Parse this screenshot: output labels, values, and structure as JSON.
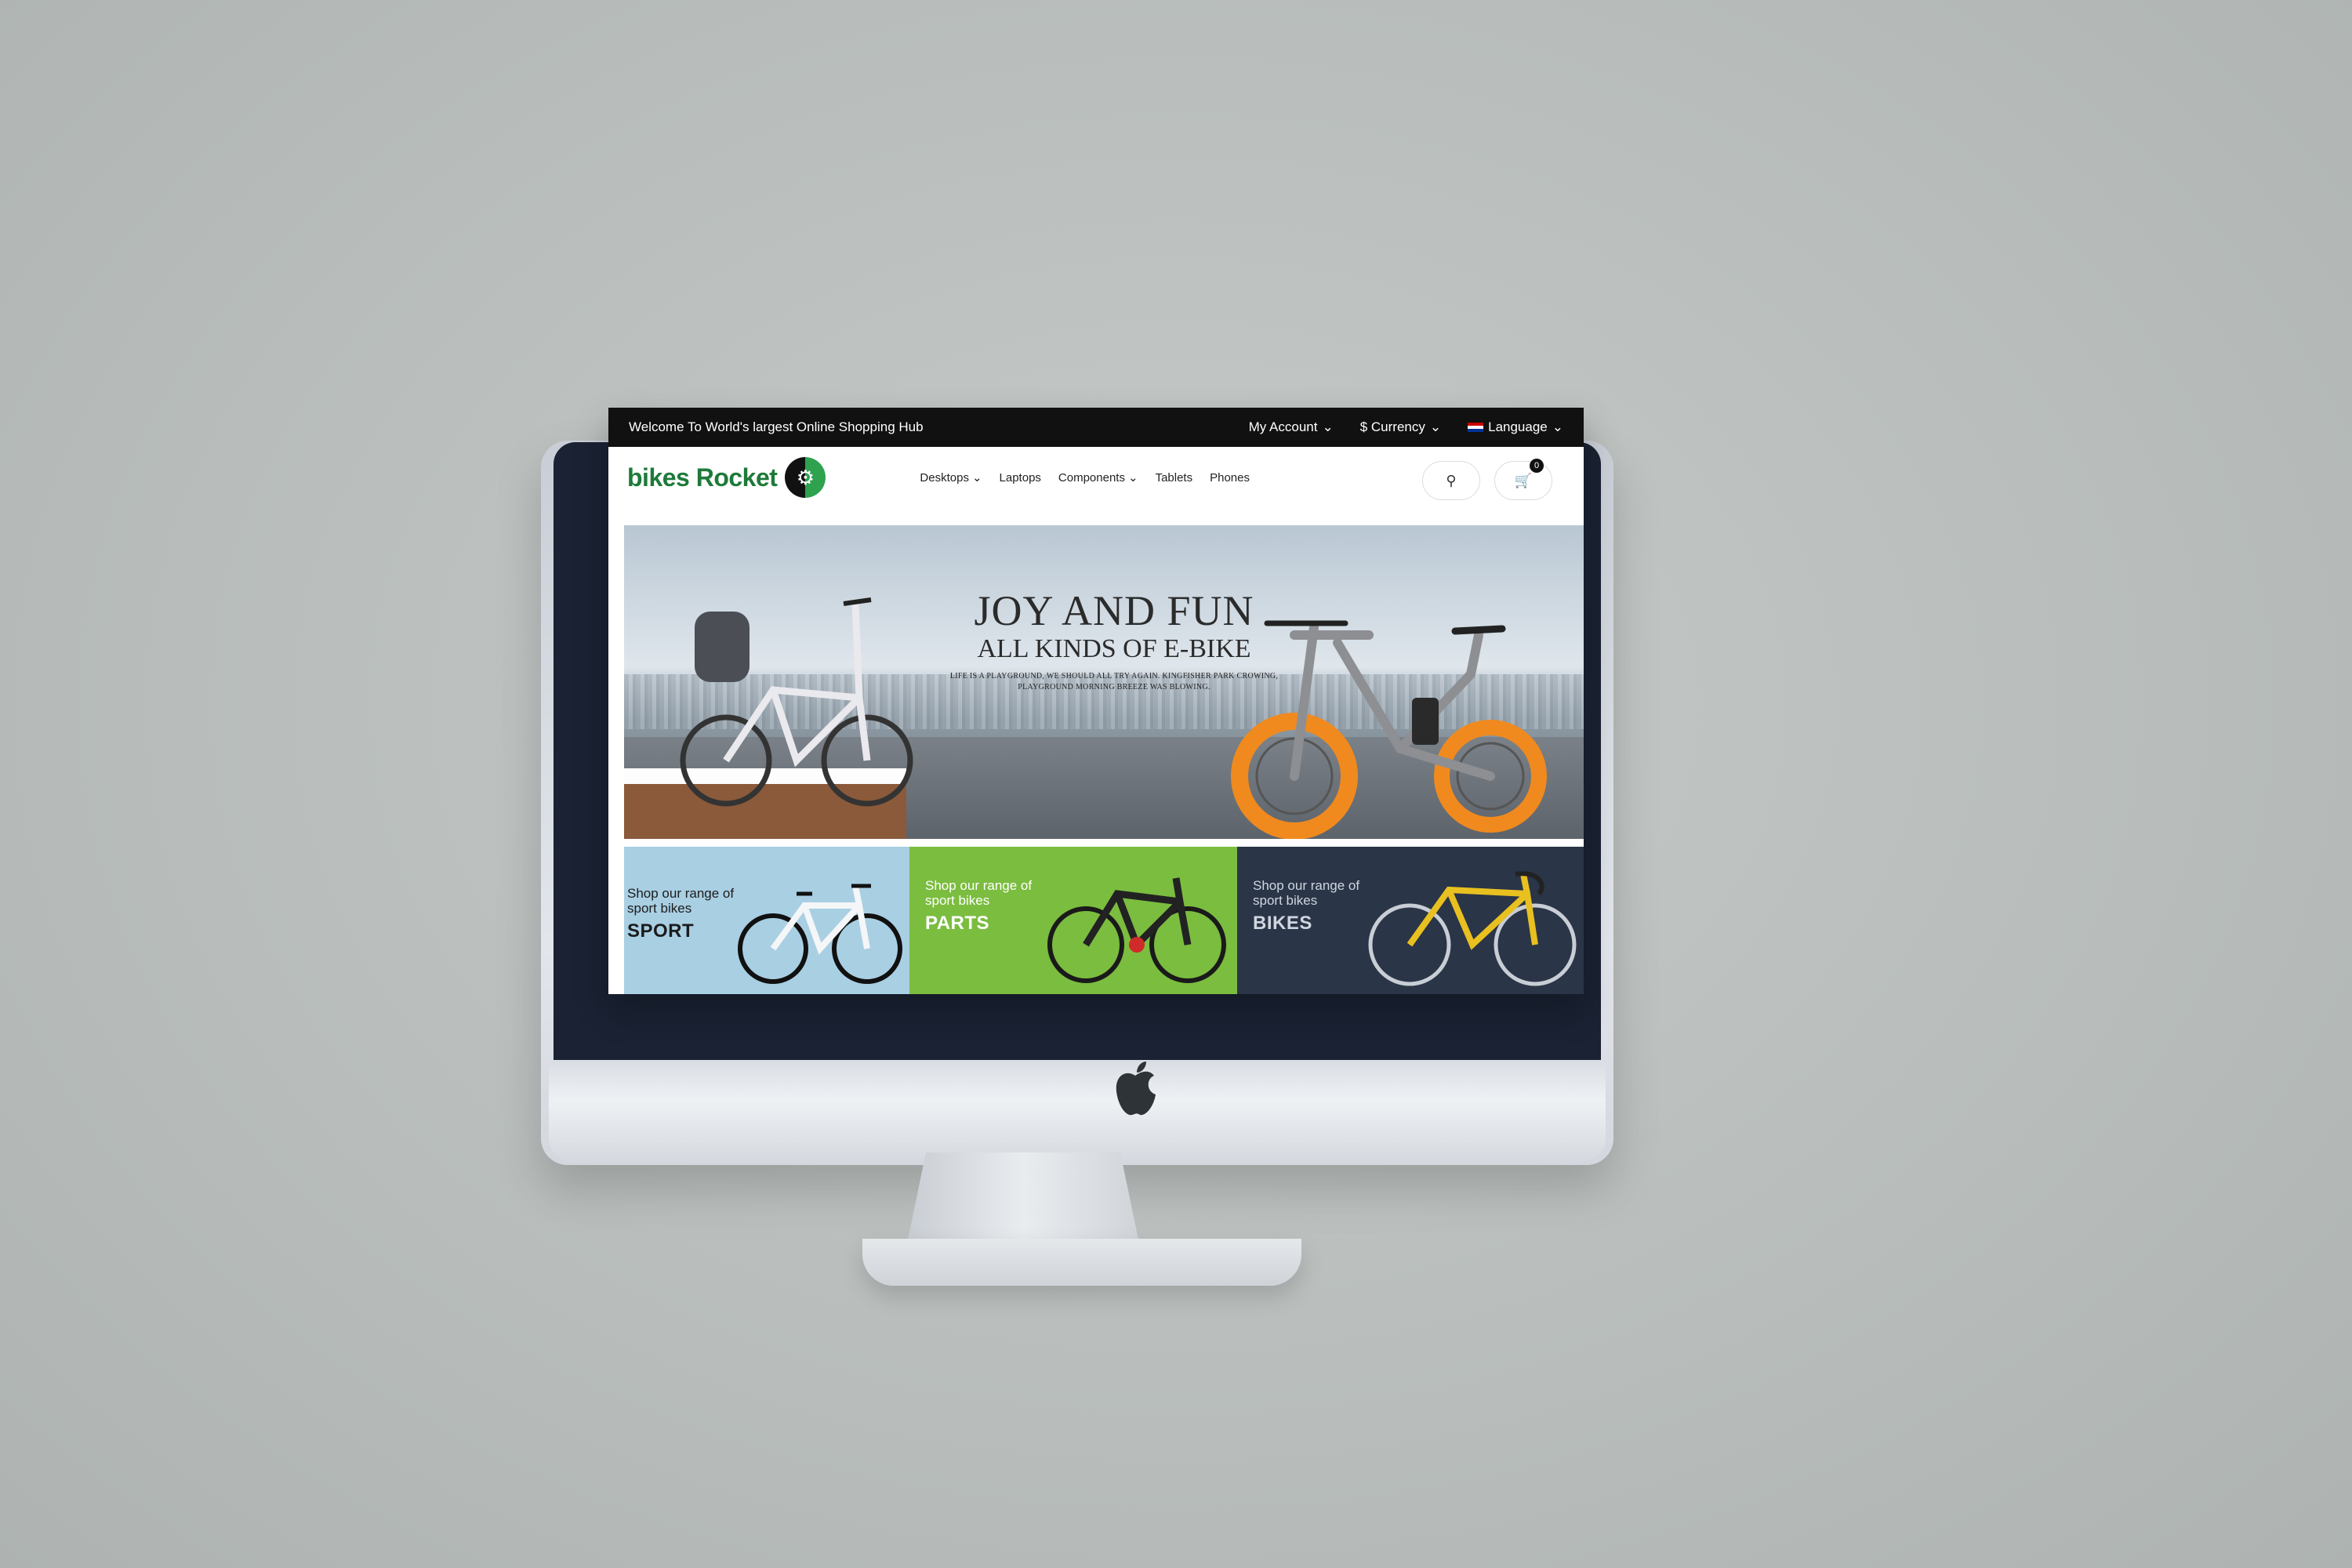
{
  "topbar": {
    "welcome": "Welcome To World's largest Online Shopping Hub",
    "my_account": "My Account",
    "currency": "$ Currency",
    "language": "Language"
  },
  "header": {
    "logo_word1": "bikes",
    "logo_word2": "Rocket",
    "cart_count": "0"
  },
  "nav": {
    "items": [
      "Desktops",
      "Laptops",
      "Components",
      "Tablets",
      "Phones"
    ]
  },
  "hero": {
    "title": "JOY AND FUN",
    "subtitle": "ALL KINDS OF E-BIKE",
    "tagline_1": "LIFE IS A PLAYGROUND, WE SHOULD ALL TRY AGAIN. KINGFISHER PARK CROWING,",
    "tagline_2": "PLAYGROUND MORNING BREEZE WAS BLOWING."
  },
  "tiles": [
    {
      "copy_1": "Shop our range of",
      "copy_2": "sport bikes",
      "title": "SPORT"
    },
    {
      "copy_1": "Shop our range of",
      "copy_2": "sport bikes",
      "title": "PARTS"
    },
    {
      "copy_1": "Shop our range of",
      "copy_2": "sport bikes",
      "title": "BIKES"
    }
  ],
  "colors": {
    "topbar_bg": "#111111",
    "brand_green": "#1e7a3a",
    "tile_sport": "#a9cfe3",
    "tile_parts": "#7bbd3f",
    "tile_bikes": "#2a3547",
    "accent_orange": "#f08a1e"
  },
  "icons": {
    "device_logo": "apple-logo-icon",
    "search": "search-icon",
    "cart": "cart-icon",
    "chevron": "chevron-down-icon"
  }
}
